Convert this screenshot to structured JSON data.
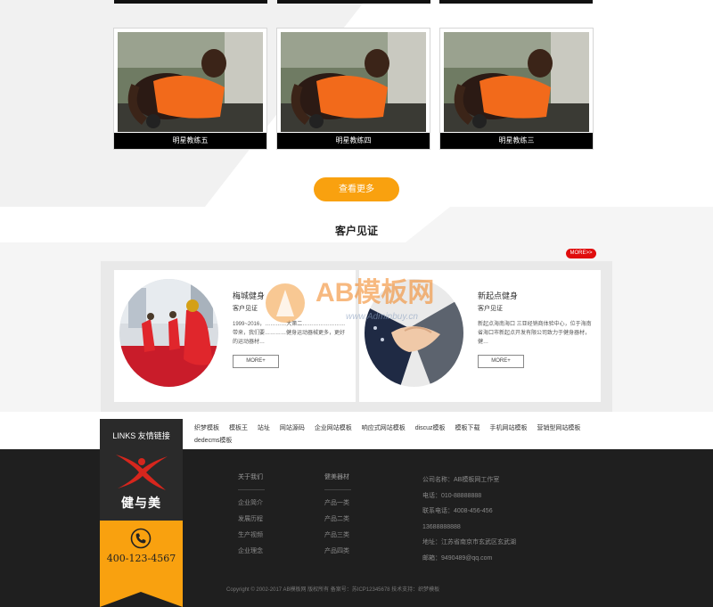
{
  "coaches": {
    "cards": [
      {
        "caption": "明星教练五"
      },
      {
        "caption": "明星教练四"
      },
      {
        "caption": "明星教练三"
      }
    ],
    "more_button": "查看更多"
  },
  "testimonials": {
    "title": "客户见证",
    "more_tag": "MORE>>",
    "cards": [
      {
        "name": "梅城健身",
        "subtitle": "客户见证",
        "text": "1999~2016，…………大第二……………………带来，我们要…………健身运动器械更多，更好的运动器材…",
        "more": "MORE+"
      },
      {
        "name": "新起点健身",
        "subtitle": "客户见证",
        "text": "新起点海南海口 三亚经销商体验中心，位于海南省海口市新起点开发有限公司致力于健身器材，健…",
        "more": "MORE+"
      }
    ]
  },
  "watermark": {
    "text": "AB模板网",
    "url": "www.Adminbuy.cn"
  },
  "links": {
    "title": "LINKS 友情链接",
    "items": [
      "织梦模板",
      "模板王",
      "站址",
      "网站源码",
      "企业网站模板",
      "响应式网站模板",
      "discuz模板",
      "模板下载",
      "手机网站模板",
      "营销型网站模板",
      "dedecms模板"
    ]
  },
  "logo": {
    "brand_cn": "健与美",
    "phone": "400-123-4567"
  },
  "footer": {
    "col1": {
      "head": "关于我们",
      "items": [
        "企业简介",
        "发展历程",
        "生产视频",
        "企业理念"
      ]
    },
    "col2": {
      "head": "健美器材",
      "items": [
        "产品一类",
        "产品二类",
        "产品三类",
        "产品四类"
      ]
    },
    "contact": [
      "公司名称：AB模板网工作室",
      "电话：010-88888888",
      "联系电话：4008-456-456",
      "13688888888",
      "地址：江苏省南京市玄武区玄武湖",
      "邮箱：9490489@qq.com"
    ],
    "copyright": "Copyright © 2002-2017 AB模板网 版权所有 备案号：苏ICP12345678 技术支持：织梦模板"
  },
  "colors": {
    "accent": "#f9a10f",
    "footer_bg": "#1f1f1f",
    "logo_red": "#d6261d",
    "tag_red": "#e00d0d"
  }
}
